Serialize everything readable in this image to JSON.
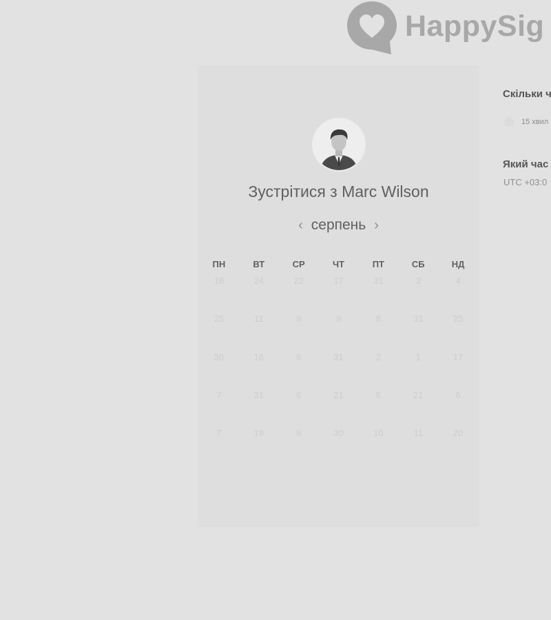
{
  "logo": {
    "text": "HappySig",
    "icon": "heart-speech-bubble-icon",
    "color": "#a8a8a8"
  },
  "booking": {
    "title": "Зустрітися з Marc Wilson",
    "avatar": "person-photo",
    "month": "серпень",
    "prev_icon": "chevron-left-icon",
    "next_icon": "chevron-right-icon",
    "weekdays": [
      "ПН",
      "ВТ",
      "СР",
      "ЧТ",
      "ПТ",
      "СБ",
      "НД"
    ],
    "days": [
      [
        "18",
        "24",
        "22",
        "17",
        "31",
        "3",
        "4"
      ],
      [
        "25",
        "11",
        "9",
        "9",
        "8",
        "31",
        "25"
      ],
      [
        "30",
        "16",
        "8",
        "31",
        "2",
        "1",
        "17"
      ],
      [
        "7",
        "31",
        "6",
        "21",
        "8",
        "21",
        "6"
      ],
      [
        "7",
        "19",
        "6",
        "30",
        "10",
        "11",
        "20"
      ]
    ]
  },
  "sidebar": {
    "question1": "Скільки ч",
    "duration_option": "15 хвил",
    "question2": "Який час",
    "timezone": "UTC +03:0"
  }
}
